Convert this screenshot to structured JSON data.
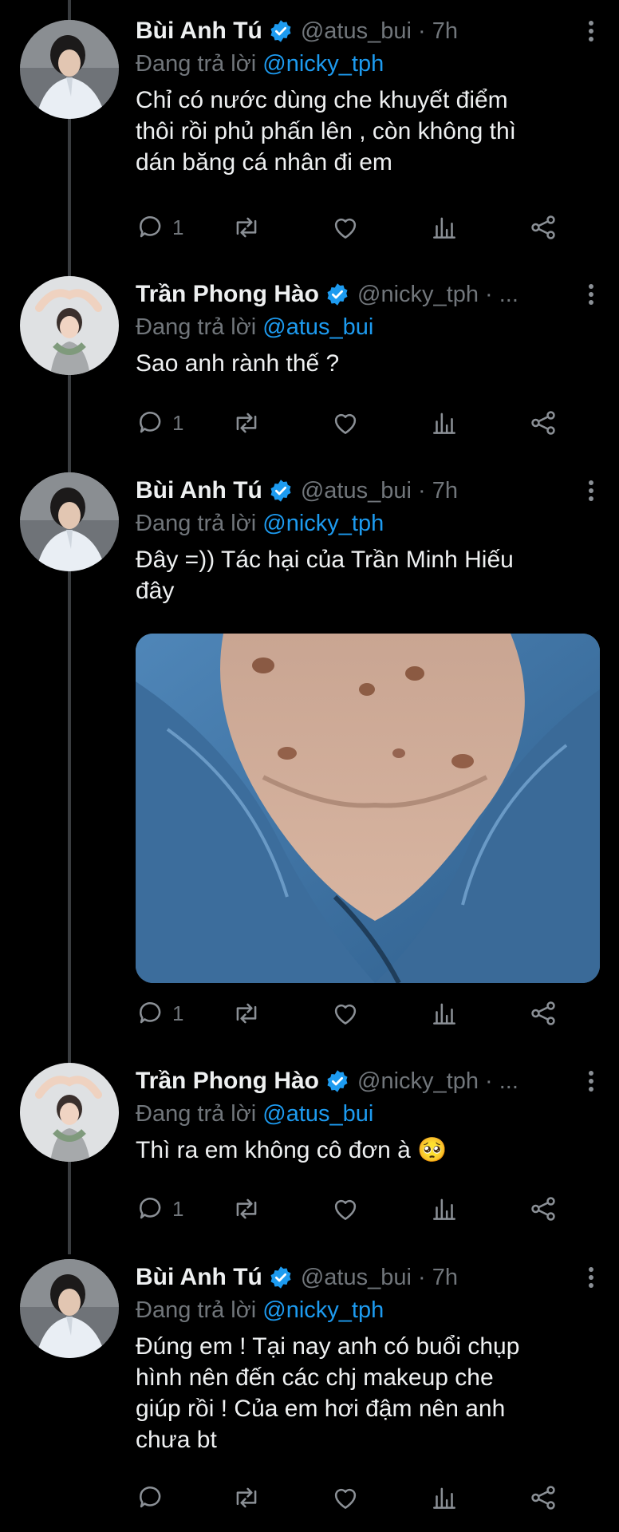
{
  "tweets": [
    {
      "name": "Bùi Anh Tú",
      "handle": "@atus_bui · 7h",
      "reply_prefix": "Đang trả lời ",
      "reply_to": "@nicky_tph",
      "text": "Chỉ có nước dùng che khuyết điểm\nthôi rồi phủ phấn lên , còn không thì\ndán băng cá nhân đi em",
      "reply_count": "1"
    },
    {
      "name": "Trần Phong Hào",
      "handle": "@nicky_tph · ...",
      "reply_prefix": "Đang trả lời ",
      "reply_to": "@atus_bui",
      "text": "Sao anh rành thế ?",
      "reply_count": "1"
    },
    {
      "name": "Bùi Anh Tú",
      "handle": "@atus_bui · 7h",
      "reply_prefix": "Đang trả lời ",
      "reply_to": "@nicky_tph",
      "text": "Đây =)) Tác hại của Trần Minh Hiếu\nđây",
      "reply_count": "1"
    },
    {
      "name": "Trần Phong Hào",
      "handle": "@nicky_tph · ...",
      "reply_prefix": "Đang trả lời ",
      "reply_to": "@atus_bui",
      "text": "Thì ra em không cô đơn à 🥺",
      "reply_count": "1"
    },
    {
      "name": "Bùi Anh Tú",
      "handle": "@atus_bui · 7h",
      "reply_prefix": "Đang trả lời ",
      "reply_to": "@nicky_tph",
      "text": "Đúng em ! Tại nay anh có buổi chụp\nhình nên đến các chj makeup che\ngiúp rồi ! Của em hơi đậm nên anh\nchưa bt",
      "reply_count": ""
    }
  ],
  "colors": {
    "background": "#000000",
    "text": "#e7e9ea",
    "muted": "#71767b",
    "accent": "#1d9bf0",
    "thread_line": "#3a3d40"
  },
  "icons": {
    "verified": "verified-badge-icon",
    "more": "more-vertical-icon",
    "reply": "reply-icon",
    "retweet": "retweet-icon",
    "like": "heart-icon",
    "views": "analytics-icon",
    "share": "share-icon"
  }
}
